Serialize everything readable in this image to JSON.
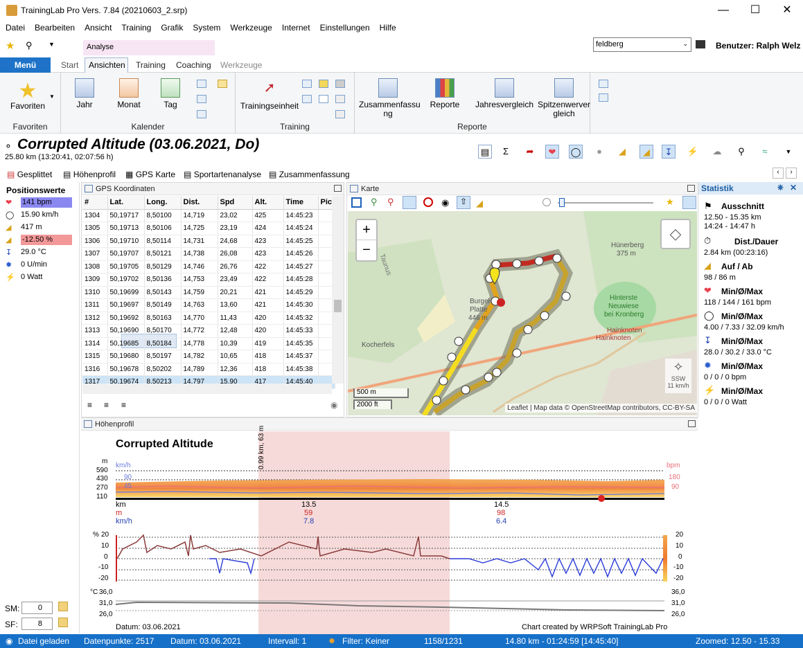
{
  "app": {
    "title": "TrainingLab Pro Vers. 7.84 (20210603_2.srp)"
  },
  "menu": [
    "Datei",
    "Bearbeiten",
    "Ansicht",
    "Training",
    "Grafik",
    "System",
    "Werkzeuge",
    "Internet",
    "Einstellungen",
    "Hilfe"
  ],
  "context_tab": "Analyse",
  "search": {
    "value": "feldberg"
  },
  "user": "Benutzer: Ralph Welz",
  "ribbon_tabs": {
    "menu": "Menü",
    "start": "Start",
    "ansichten": "Ansichten",
    "training": "Training",
    "coaching": "Coaching",
    "werkzeuge": "Werkzeuge"
  },
  "ribbon": {
    "favoriten": "Favoriten",
    "jahr": "Jahr",
    "monat": "Monat",
    "tag": "Tag",
    "kalender": "Kalender",
    "trainingseinheit": "Trainingseinheit",
    "training": "Training",
    "zusammenfassung": "Zusammenfassu ng",
    "reporte_btn": "Reporte",
    "jahresvergleich": "Jahresvergleich",
    "spitzenwert": "Spitzenwerver gleich",
    "reporte": "Reporte",
    "favoriten_group": "Favoriten"
  },
  "activity": {
    "title": "Corrupted Altitude (03.06.2021, Do)",
    "subtitle": "25.80 km (13:20:41, 02:07:56 h)"
  },
  "view_tabs": [
    "Gesplittet",
    "Höhenprofil",
    "GPS Karte",
    "Sportartenanalyse",
    "Zusammenfassung"
  ],
  "positions": {
    "title": "Positionswerte",
    "hr": "141 bpm",
    "speed": "15.90 km/h",
    "alt": "417 m",
    "grade": "-12.50 %",
    "temp": "29.0 °C",
    "cadence": "0 U/min",
    "power": "0 Watt",
    "sm_label": "SM:",
    "sm": "0",
    "sf_label": "SF:",
    "sf": "8"
  },
  "gps": {
    "title": "GPS Koordinaten",
    "columns": [
      "#",
      "Lat.",
      "Long.",
      "Dist.",
      "Spd",
      "Alt.",
      "Time",
      "Pic"
    ],
    "rows": [
      [
        "1304",
        "50,19717",
        "8,50100",
        "14,719",
        "23,02",
        "425",
        "14:45:23",
        ""
      ],
      [
        "1305",
        "50,19713",
        "8,50106",
        "14,725",
        "23,19",
        "424",
        "14:45:24",
        ""
      ],
      [
        "1306",
        "50,19710",
        "8,50114",
        "14,731",
        "24,68",
        "423",
        "14:45:25",
        ""
      ],
      [
        "1307",
        "50,19707",
        "8,50121",
        "14,738",
        "26,08",
        "423",
        "14:45:26",
        ""
      ],
      [
        "1308",
        "50,19705",
        "8,50129",
        "14,746",
        "26,76",
        "422",
        "14:45:27",
        ""
      ],
      [
        "1309",
        "50,19702",
        "8,50136",
        "14,753",
        "23,49",
        "422",
        "14:45:28",
        ""
      ],
      [
        "1310",
        "50,19699",
        "8,50143",
        "14,759",
        "20,21",
        "421",
        "14:45:29",
        ""
      ],
      [
        "1311",
        "50,19697",
        "8,50149",
        "14,763",
        "13,60",
        "421",
        "14:45:30",
        ""
      ],
      [
        "1312",
        "50,19692",
        "8,50163",
        "14,770",
        "11,43",
        "420",
        "14:45:32",
        ""
      ],
      [
        "1313",
        "50,19690",
        "8,50170",
        "14,772",
        "12,48",
        "420",
        "14:45:33",
        ""
      ],
      [
        "1314",
        "50,19685",
        "8,50184",
        "14,778",
        "10,39",
        "419",
        "14:45:35",
        ""
      ],
      [
        "1315",
        "50,19680",
        "8,50197",
        "14,782",
        "10,65",
        "418",
        "14:45:37",
        ""
      ],
      [
        "1316",
        "50,19678",
        "8,50202",
        "14,789",
        "12,36",
        "418",
        "14:45:38",
        ""
      ],
      [
        "1317",
        "50,19674",
        "8,50213",
        "14,797",
        "15,90",
        "417",
        "14:45:40",
        ""
      ]
    ]
  },
  "map": {
    "title": "Karte",
    "zoom_in": "+",
    "zoom_out": "−",
    "scale_m": "500 m",
    "scale_ft": "2000 ft",
    "attribution": "Leaflet | Map data © OpenStreetMap contributors, CC-BY-SA",
    "labels": {
      "huenerberg": "Hünerberg",
      "huenerberg_h": "375 m",
      "burgel": "Burgel-",
      "platte": "Platte",
      "burgel_h": "446 m",
      "hinterste": "Hinterste",
      "neuwiese": "Neuwiese",
      "kronberg": "bei Kronberg",
      "hainknoten": "Hainknoten",
      "kocherfels": "Kocherfels",
      "taunus": "Taunus"
    },
    "compass": "SSW",
    "compass_dist": "11 km/h"
  },
  "stats": {
    "title": "Statistik",
    "ausschnitt": "Ausschnitt",
    "a1": "12.50 - 15.35 km",
    "a2": "14:24 - 14:47 h",
    "dist": "Dist./Dauer",
    "dist_v": "2.84 km (00:23:16)",
    "aufab": "Auf / Ab",
    "aufab_v": "98 / 86 m",
    "hr": "Min/Ø/Max",
    "hr_v": "118 / 144 / 161 bpm",
    "spd": "Min/Ø/Max",
    "spd_v": "4.00 / 7.33 / 32.09 km/h",
    "temp": "Min/Ø/Max",
    "temp_v": "28.0 / 30.2 / 33.0 °C",
    "cad": "Min/Ø/Max",
    "cad_v": "0 / 0 / 0 bpm",
    "pow": "Min/Ø/Max",
    "pow_v": "0 / 0 / 0 Watt"
  },
  "profile": {
    "title": "Höhenprofil",
    "chart_title": "Corrupted Altitude",
    "marker": "0.99 km, 63 m",
    "m": "m",
    "kmh": "km/h",
    "bpm": "bpm",
    "y_m": [
      "590",
      "430",
      "270",
      "110"
    ],
    "y_kmh": [
      "90",
      "45"
    ],
    "y_bpm": [
      "180",
      "90"
    ],
    "x_label": "km",
    "x_m": "m",
    "x_kmh": "km/h",
    "x1": "13.5",
    "x2": "14.5",
    "m1": "59",
    "m2": "98",
    "s1": "7.8",
    "s2": "6.4",
    "pct": "%",
    "y_pct": [
      "20",
      "10",
      "0",
      "-10",
      "-20"
    ],
    "degc": "°C",
    "y_temp": [
      "36,0",
      "31,0",
      "26,0"
    ],
    "date": "Datum: 03.06.2021",
    "credit": "Chart created by WRPSoft TrainingLab Pro"
  },
  "status": {
    "loaded": "Datei geladen",
    "points": "Datenpunkte: 2517",
    "date": "Datum: 03.06.2021",
    "interval": "Intervall: 1",
    "filter": "Filter: Keiner",
    "idx": "1158/1231",
    "pos": "14.80 km - 01:24:59 [14:45:40]",
    "zoom": "Zoomed:  12.50 - 15.33"
  },
  "colors": {
    "accent": "#1670c8",
    "hr": "#e8707a",
    "speed": "#6a7ae0"
  }
}
